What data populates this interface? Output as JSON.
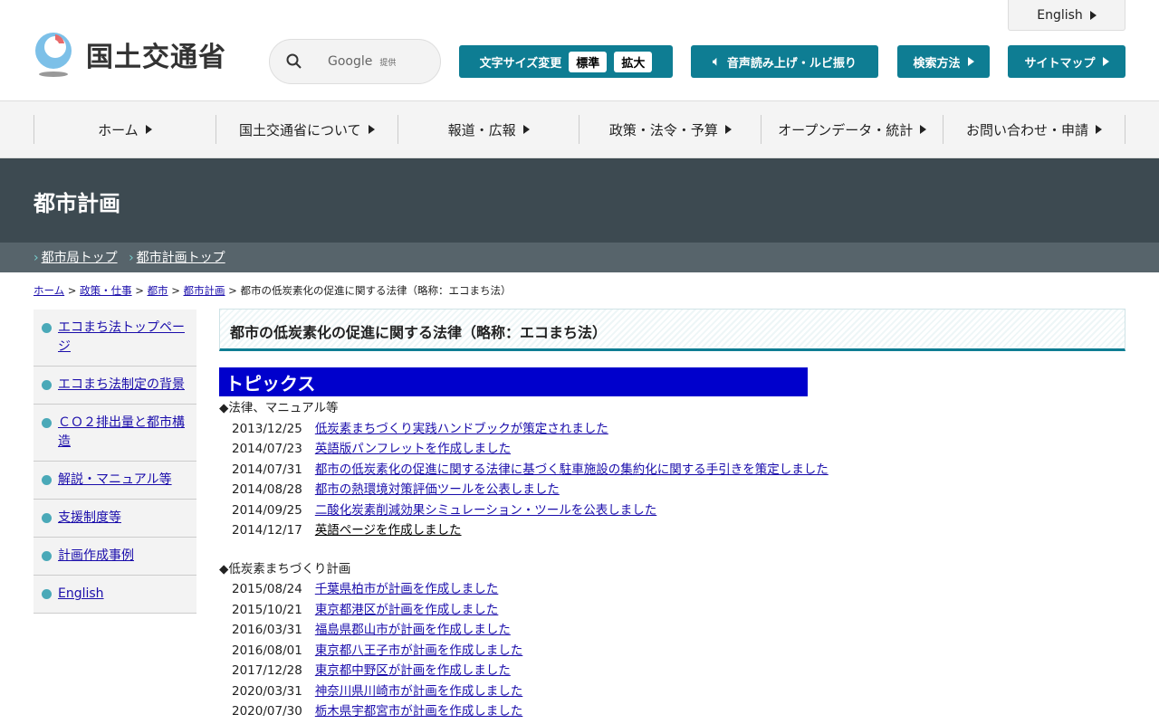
{
  "header": {
    "logo_text": "国土交通省",
    "search_brand": "Google",
    "search_provided": "提供",
    "font_size_label": "文字サイズ変更",
    "font_standard": "標準",
    "font_large": "拡大",
    "speech_label": "音声読み上げ・ルビ振り",
    "search_method": "検索方法",
    "sitemap": "サイトマップ",
    "english": "English"
  },
  "nav": [
    "ホーム",
    "国土交通省について",
    "報道・広報",
    "政策・法令・予算",
    "オープンデータ・統計",
    "お問い合わせ・申請"
  ],
  "page_title": "都市計画",
  "sub_links": [
    "都市局トップ",
    "都市計画トップ"
  ],
  "breadcrumb": {
    "links": [
      "ホーム",
      "政策・仕事",
      "都市",
      "都市計画"
    ],
    "current": "都市の低炭素化の促進に関する法律（略称：エコまち法）"
  },
  "sidebar": [
    "エコまち法トップページ",
    "エコまち法制定の背景",
    "ＣＯ２排出量と都市構造",
    "解説・マニュアル等",
    "支援制度等",
    "計画作成事例",
    "English"
  ],
  "main": {
    "heading": "都市の低炭素化の促進に関する法律（略称：エコまち法）",
    "topics": "トピックス",
    "sections": [
      {
        "title": "◆法律、マニュアル等",
        "items": [
          {
            "date": "2013/12/25",
            "text": "低炭素まちづくり実践ハンドブックが策定されました"
          },
          {
            "date": "2014/07/23",
            "text": "英語版パンフレットを作成しました"
          },
          {
            "date": "2014/07/31",
            "text": "都市の低炭素化の促進に関する法律に基づく駐車施設の集約化に関する手引きを策定しました"
          },
          {
            "date": "2014/08/28",
            "text": "都市の熱環境対策評価ツールを公表しました"
          },
          {
            "date": "2014/09/25",
            "text": "二酸化炭素削減効果シミュレーション・ツールを公表しました"
          },
          {
            "date": "2014/12/17",
            "text": "英語ページを作成しました"
          }
        ]
      },
      {
        "title": "◆低炭素まちづくり計画",
        "items": [
          {
            "date": "2015/08/24",
            "text": "千葉県柏市が計画を作成しました"
          },
          {
            "date": "2015/10/21",
            "text": "東京都港区が計画を作成しました"
          },
          {
            "date": "2016/03/31",
            "text": "福島県郡山市が計画を作成しました"
          },
          {
            "date": "2016/08/01",
            "text": "東京都八王子市が計画を作成しました"
          },
          {
            "date": "2017/12/28",
            "text": "東京都中野区が計画を作成しました"
          },
          {
            "date": "2020/03/31",
            "text": "神奈川県川崎市が計画を作成しました"
          },
          {
            "date": "2020/07/30",
            "text": "栃木県宇都宮市が計画を作成しました"
          }
        ]
      }
    ]
  }
}
